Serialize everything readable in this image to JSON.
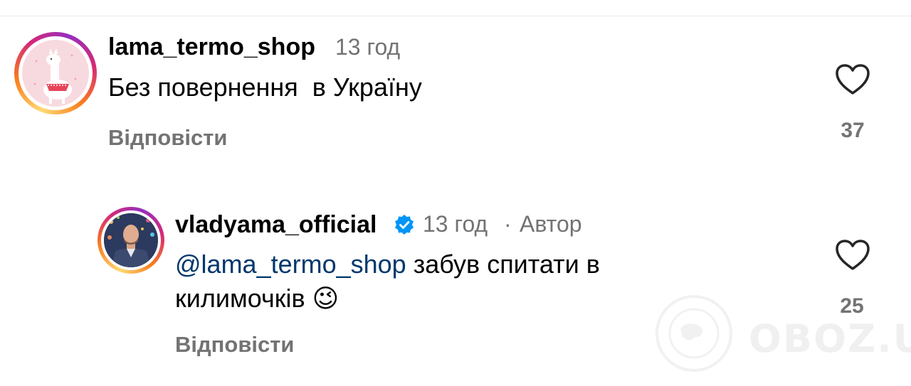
{
  "comments": [
    {
      "username": "lama_termo_shop",
      "time": "13 год",
      "text": "Без повернення  в Україну",
      "reply_label": "Відповісти",
      "likes": "37",
      "avatar_icon": "llama-avatar-icon"
    },
    {
      "username": "vladyama_official",
      "time": "13 год",
      "separator": "·",
      "author_badge": "Автор",
      "mention": "@lama_termo_shop",
      "text_line1": " забув спитати в",
      "text_line2": "килимочків",
      "emoji": "😉",
      "reply_label": "Відповісти",
      "likes": "25",
      "verified": true
    }
  ],
  "watermark": {
    "text": "OBOZ.UA"
  },
  "colors": {
    "secondary_text": "#737373",
    "mention": "#00376b",
    "verified": "#0095f6"
  }
}
